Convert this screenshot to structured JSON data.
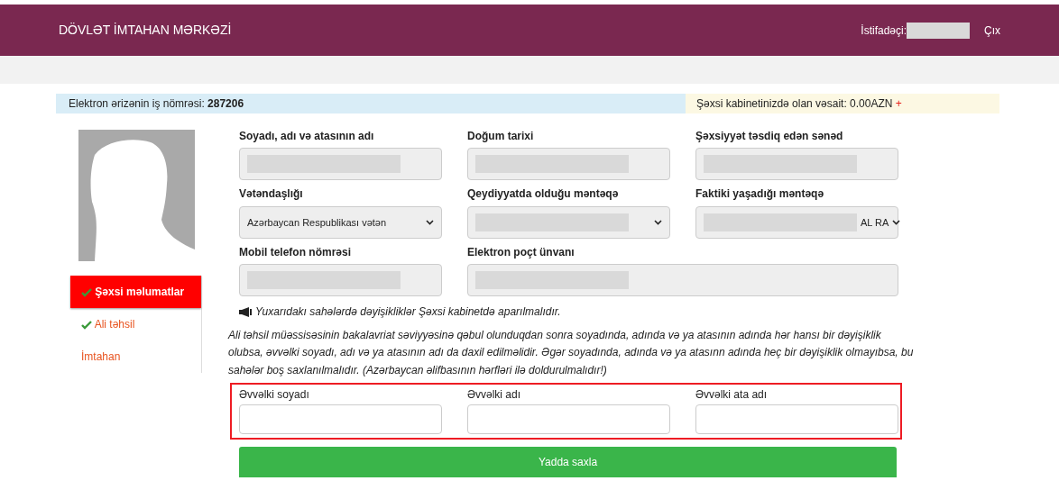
{
  "header": {
    "title": "DÖVLƏT İMTAHAN MƏRKƏZİ",
    "user_label": "İstifadəçi:",
    "user_redacted": true,
    "logout": "Çıx"
  },
  "info_bar": {
    "application_label": "Elektron ərizənin iş nömrəsi:",
    "application_number": "287206",
    "balance": "Şəxsi kabinetinizdə olan vəsait: 0.00AZN",
    "add": "+"
  },
  "sidebar": {
    "items": [
      {
        "label": "Şəxsi məlumatlar",
        "completed": true,
        "selected": true
      },
      {
        "label": "Ali təhsil",
        "completed": true,
        "selected": false
      },
      {
        "label": "İmtahan",
        "completed": false,
        "selected": false
      }
    ]
  },
  "fields": [
    {
      "label": "Soyadı, adı və atasının adı",
      "kind": "input",
      "redacted": true
    },
    {
      "label": "Doğum tarixi",
      "kind": "input",
      "redacted": true
    },
    {
      "label": "Şəxsiyyət təsdiq edən sənəd",
      "kind": "input",
      "redacted": true
    },
    {
      "label": "Vətəndaşlığı",
      "kind": "select",
      "value": "Azərbaycan Respublikası vətən"
    },
    {
      "label": "Qeydiyyatda olduğu məntəqə",
      "kind": "select",
      "redacted": true
    },
    {
      "label": "Faktiki yaşadığı məntəqə",
      "kind": "select",
      "redacted": true,
      "value": "AL RA"
    },
    {
      "label": "Mobil telefon nömrəsi",
      "kind": "input",
      "redacted": true
    },
    {
      "label": "Elektron poçt ünvanı",
      "kind": "input",
      "redacted": true
    }
  ],
  "notice": "Yuxarıdakı sahələrdə dəyişikliklər Şəxsi kabinetdə aparılmalıdır.",
  "instructions": "Ali təhsil müəssisəsinin bakalavriat səviyyəsinə qəbul olunduqdan sonra soyadında, adında və ya atasının adında hər hansı bir dəyişiklik olubsa, əvvəlki soyadı, adı və ya atasının adı da daxil edilməlidir. Əgər soyadında, adında və ya atasınn adında heç bir dəyişiklik olmayıbsa, bu sahələr boş saxlanılmalıdır. (Azərbaycan əlifbasının hərfləri ilə doldurulmalıdır!)",
  "previous_names": [
    {
      "label": "Əvvəlki soyadı"
    },
    {
      "label": "Əvvəlki adı"
    },
    {
      "label": "Əvvəlki ata adı"
    }
  ],
  "save_button": "Yadda saxla"
}
